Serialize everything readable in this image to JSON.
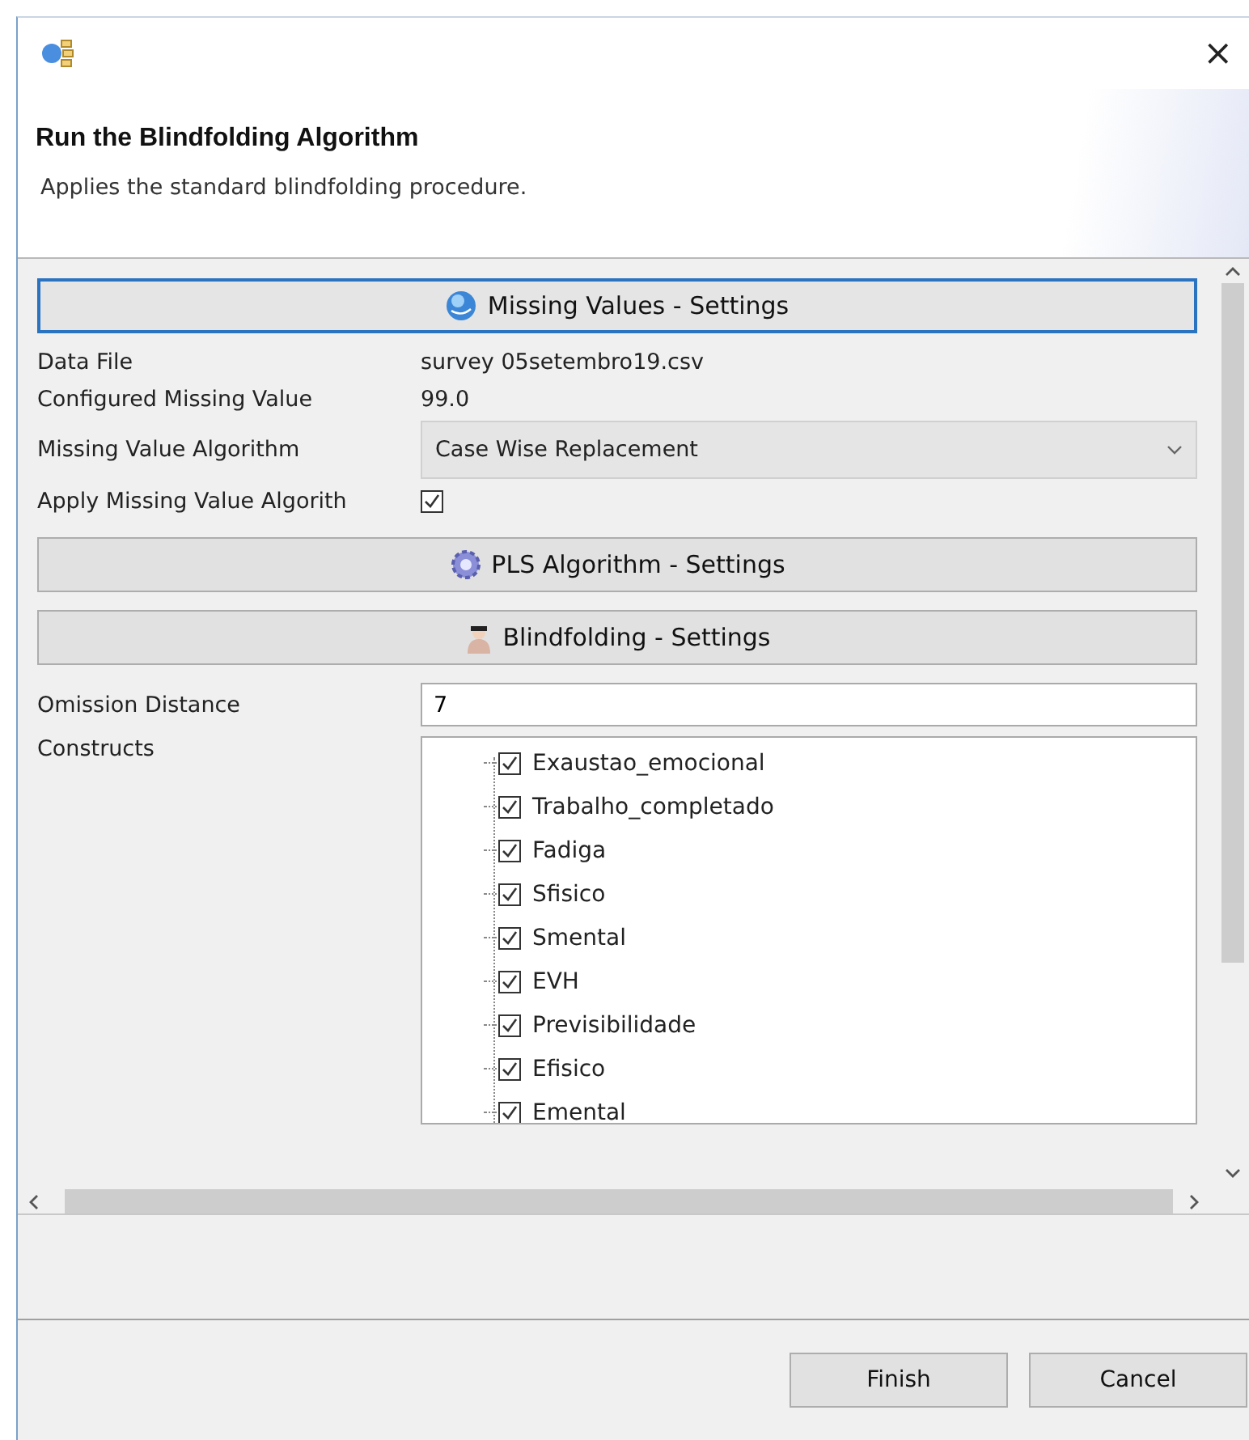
{
  "window": {
    "close": "×"
  },
  "header": {
    "title": "Run the Blindfolding Algorithm",
    "description": "Applies the standard blindfolding procedure."
  },
  "sections": [
    {
      "label": "Missing Values - Settings",
      "kind": "globe",
      "selected": true,
      "fields": [
        {
          "kind": "text",
          "label": "Data File",
          "value": "survey 05setembro19.csv"
        },
        {
          "kind": "text",
          "label": "Configured Missing Value",
          "value": "99.0"
        },
        {
          "kind": "dropdown",
          "label": "Missing Value Algorithm",
          "value": "Case Wise Replacement"
        },
        {
          "kind": "checkbox",
          "label": "Apply Missing Value Algorith",
          "checked": true
        }
      ]
    },
    {
      "label": "PLS Algorithm - Settings",
      "kind": "gear",
      "selected": false
    },
    {
      "label": "Blindfolding - Settings",
      "kind": "person",
      "selected": false,
      "fields": [
        {
          "kind": "input",
          "label": "Omission Distance",
          "value": "7"
        },
        {
          "kind": "tree",
          "label": "Constructs",
          "items": [
            {
              "label": "Exaustao_emocional",
              "checked": true
            },
            {
              "label": "Trabalho_completado",
              "checked": true
            },
            {
              "label": "Fadiga",
              "checked": true
            },
            {
              "label": "Sfisico",
              "checked": true
            },
            {
              "label": "Smental",
              "checked": true
            },
            {
              "label": "EVH",
              "checked": true
            },
            {
              "label": "Previsibilidade",
              "checked": true
            },
            {
              "label": "Efisico",
              "checked": true
            },
            {
              "label": "Emental",
              "checked": true
            }
          ]
        }
      ]
    }
  ],
  "buttons": [
    "Finish",
    "Cancel"
  ]
}
